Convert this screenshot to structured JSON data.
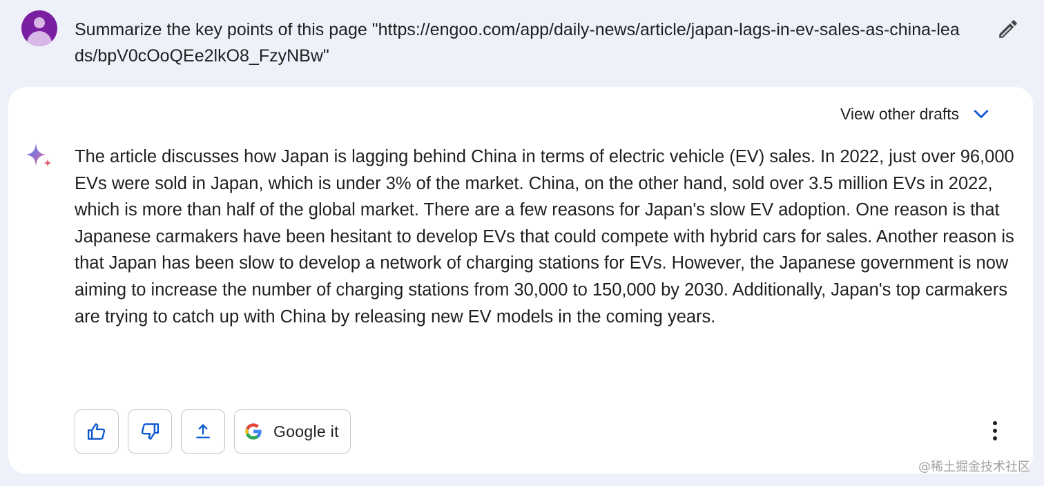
{
  "prompt": {
    "text": "Summarize the key points of this page \"https://engoo.com/app/daily-news/article/japan-lags-in-ev-sales-as-china-leads/bpV0cOoQEe2lkO8_FzyNBw\"",
    "avatar_icon": "user-avatar-icon",
    "edit_icon": "pencil-icon"
  },
  "response": {
    "drafts_label": "View other drafts",
    "drafts_icon": "chevron-down-icon",
    "model_icon": "sparkle-icon",
    "text": "The article discusses how Japan is lagging behind China in terms of electric vehicle (EV) sales. In 2022, just over 96,000 EVs were sold in Japan, which is under 3% of the market. China, on the other hand, sold over 3.5 million EVs in 2022, which is more than half of the global market. There are a few reasons for Japan's slow EV adoption. One reason is that Japanese carmakers have been hesitant to develop EVs that could compete with hybrid cars for sales. Another reason is that Japan has been slow to develop a network of charging stations for EVs. However, the Japanese government is now aiming to increase the number of charging stations from 30,000 to 150,000 by 2030. Additionally, Japan's top carmakers are trying to catch up with China by releasing new EV models in the coming years."
  },
  "actions": {
    "thumbs_up_icon": "thumbs-up-icon",
    "thumbs_down_icon": "thumbs-down-icon",
    "share_icon": "share-icon",
    "google_it_label": "Google it",
    "google_icon": "google-g-icon",
    "more_icon": "more-vert-icon"
  },
  "watermark": "@稀土掘金技术社区",
  "colors": {
    "page_bg": "#eef0fa",
    "card_bg": "#ffffff",
    "accent_blue": "#0b57d0",
    "avatar_purple": "#7b1fa2"
  }
}
